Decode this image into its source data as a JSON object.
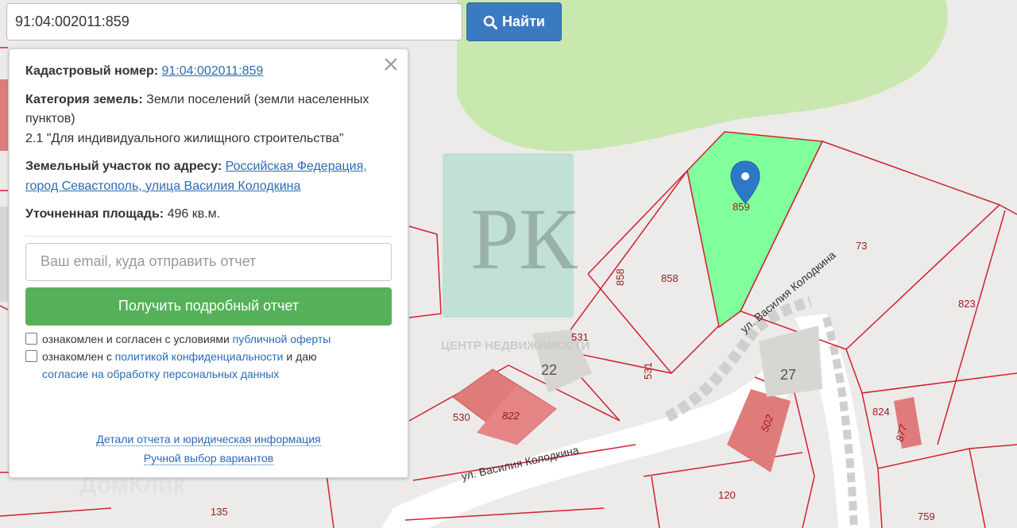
{
  "search": {
    "value": "91:04:002011:859",
    "button_label": "Найти"
  },
  "panel": {
    "cadastral_label": "Кадастровый номер:",
    "cadastral_value": "91:04:002011:859",
    "category_label": "Категория земель:",
    "category_value": "Земли поселений (земли населенных пунктов)",
    "category_use": "2.1 \"Для индивидуального жилищного строительства\"",
    "address_label": "Земельный участок по адресу:",
    "address_value": "Российская Федерация, город Севастополь, улица Василия Колодкина",
    "area_label": "Уточненная площадь:",
    "area_value": "496 кв.м.",
    "email_placeholder": "Ваш email, куда отправить отчет",
    "report_button": "Получить подробный отчет",
    "consent1_text": "ознакомлен и согласен с условиями",
    "consent1_link": "публичной оферты",
    "consent2_text": "ознакомлен с",
    "consent2_link": "политикой конфиденциальности",
    "consent2_text2": "и даю",
    "consent2_link2": "согласие на обработку персональных данных",
    "details_link": "Детали отчета и юридическая информация",
    "manual_link": "Ручной выбор вариантов"
  },
  "map": {
    "street_name": "ул. Василия Колодкина",
    "street_name_lower": "ул. Василия Колодкина",
    "parcels": [
      "859",
      "858",
      "858",
      "73",
      "823",
      "531",
      "531",
      "530",
      "822",
      "502",
      "824",
      "877",
      "120",
      "135",
      "759"
    ],
    "house_numbers": [
      "22",
      "27"
    ],
    "watermark_center": "ЦЕНТР НЕДВИЖИМОСТИ",
    "watermark_logo": "РК",
    "watermark_brand": "ДомКлик",
    "selected_color": "#80ff9c",
    "parcel_border_color": "#d2202e"
  }
}
